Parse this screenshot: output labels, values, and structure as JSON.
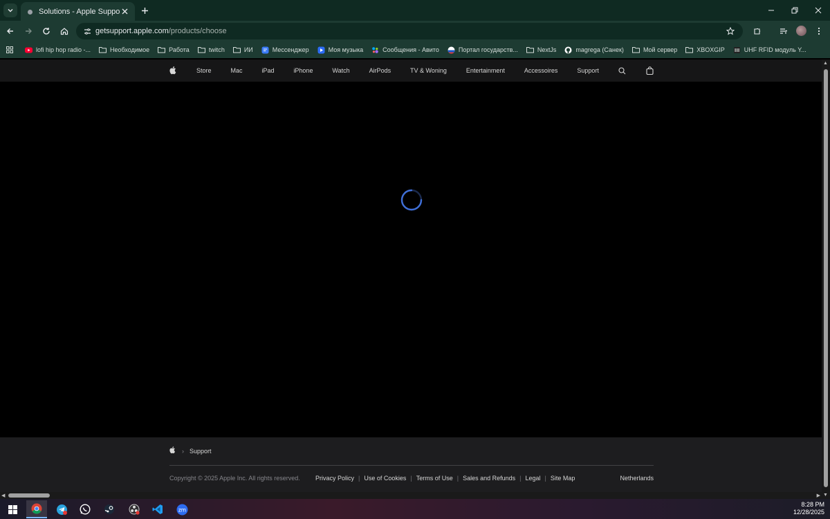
{
  "browser": {
    "tab_title": "Solutions - Apple Support",
    "url_host": "getsupport.apple.com",
    "url_path": "/products/choose",
    "bookmarks": [
      {
        "label": "lofi hip hop radio -...",
        "icon": "youtube-icon"
      },
      {
        "label": "Необходимое",
        "icon": "folder-icon"
      },
      {
        "label": "Работа",
        "icon": "folder-icon"
      },
      {
        "label": "twitch",
        "icon": "folder-icon"
      },
      {
        "label": "ИИ",
        "icon": "folder-icon"
      },
      {
        "label": "Мессенджер",
        "icon": "messenger-icon"
      },
      {
        "label": "Моя музыка",
        "icon": "music-icon"
      },
      {
        "label": "Сообщения - Авито",
        "icon": "avito-icon"
      },
      {
        "label": "Портал государств...",
        "icon": "gov-portal-icon"
      },
      {
        "label": "NextJs",
        "icon": "folder-icon"
      },
      {
        "label": "magrega (Санек)",
        "icon": "github-icon"
      },
      {
        "label": "Мой сервер",
        "icon": "folder-icon"
      },
      {
        "label": "XBOXGIP",
        "icon": "folder-icon"
      },
      {
        "label": "UHF RFID модуль Y...",
        "icon": "rfid-icon"
      }
    ]
  },
  "globalnav": {
    "items": [
      "Store",
      "Mac",
      "iPad",
      "iPhone",
      "Watch",
      "AirPods",
      "TV & Woning",
      "Entertainment",
      "Accessoires",
      "Support"
    ]
  },
  "footer": {
    "breadcrumb": "Support",
    "copyright": "Copyright © 2025 Apple Inc. All rights reserved.",
    "links": [
      "Privacy Policy",
      "Use of Cookies",
      "Terms of Use",
      "Sales and Refunds",
      "Legal",
      "Site Map"
    ],
    "country": "Netherlands"
  },
  "taskbar": {
    "apps": [
      "windows-start-icon",
      "chrome-icon",
      "telegram-icon",
      "whatsapp-icon",
      "steam-icon",
      "obs-icon",
      "vscode-icon",
      "zoom-icon"
    ],
    "time": "8:28 PM",
    "date": "12/28/2025"
  },
  "colors": {
    "chrome_dark": "#0f2a22",
    "chrome_mid": "#1d3b32",
    "spinner": "#3f6fd8"
  }
}
